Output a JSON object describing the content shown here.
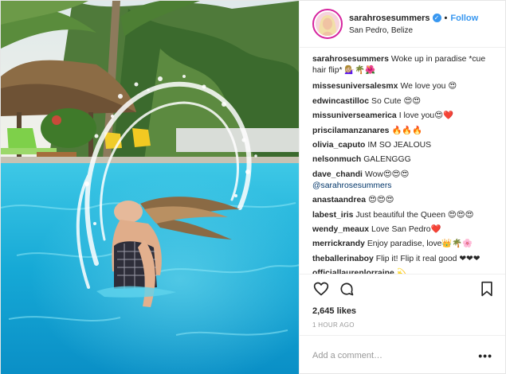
{
  "header": {
    "username": "sarahrosesummers",
    "verified_icon": "verified-badge-icon",
    "separator": "•",
    "follow_label": "Follow",
    "location": "San Pedro, Belize"
  },
  "caption": {
    "username": "sarahrosesummers",
    "text": "Woke up in paradise *cue hair flip* 💁🏼‍♀️🌴🌺"
  },
  "comments": [
    {
      "user": "missesuniversalesmx",
      "text": "We love you 😍"
    },
    {
      "user": "edwincastilloc",
      "text": "So Cute 😍😍"
    },
    {
      "user": "missuniverseamerica",
      "text": "I love you😍❤️"
    },
    {
      "user": "priscilamanzanares",
      "text": "🔥🔥🔥"
    },
    {
      "user": "olivia_caputo",
      "text": "IM SO JEALOUS"
    },
    {
      "user": "nelsonmuch",
      "text": "GALENGGG"
    },
    {
      "user": "dave_chandi",
      "text": "Wow😍😍😍",
      "mention": "@sarahrosesummers"
    },
    {
      "user": "anastaandrea",
      "text": "😍😍😍"
    },
    {
      "user": "labest_iris",
      "text": "Just beautiful the Queen 😍😍😍"
    },
    {
      "user": "wendy_meaux",
      "text": "Love San Pedro❤️"
    },
    {
      "user": "merrickrandy",
      "text": "Enjoy paradise, love👑🌴🌸"
    },
    {
      "user": "theballerinaboy",
      "text": "Flip it! Flip it real good ❤❤❤"
    },
    {
      "user": "officiallaurenlorraine",
      "text": "💫"
    }
  ],
  "actions": {
    "like_icon": "heart-icon",
    "comment_icon": "comment-bubble-icon",
    "save_icon": "bookmark-icon"
  },
  "likes": "2,645 likes",
  "time": "1 HOUR AGO",
  "add_comment": {
    "placeholder": "Add a comment…",
    "more_label": "•••"
  },
  "colors": {
    "link_blue": "#3897f0",
    "text": "#262626",
    "muted": "#999999",
    "pool": "#1fb6d9"
  }
}
